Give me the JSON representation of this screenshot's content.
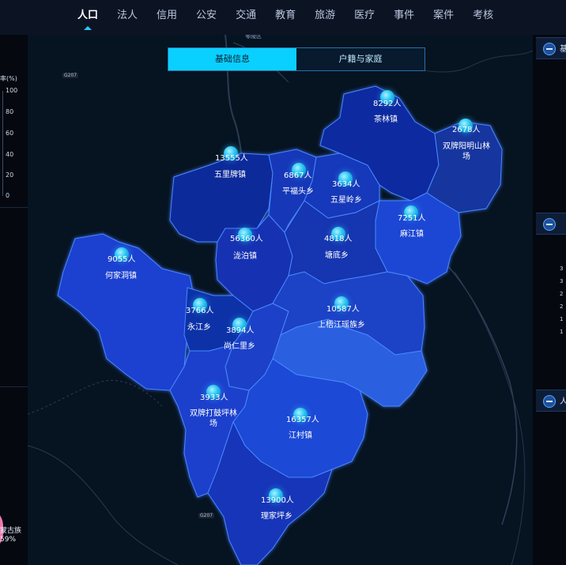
{
  "nav": {
    "tabs": [
      "人口",
      "法人",
      "信用",
      "公安",
      "交通",
      "教育",
      "旅游",
      "医疗",
      "事件",
      "案件",
      "考核"
    ],
    "active": "人口"
  },
  "segment": {
    "tab1": "基础信息",
    "tab2": "户籍与家庭",
    "active": "基础信息"
  },
  "left_panel": {
    "title": "率(%)",
    "ticks": [
      "100",
      "80",
      "60",
      "40",
      "20",
      "0"
    ],
    "pie_label_line1": "蒙古族",
    "pie_label_line2": "59%"
  },
  "right_panel": {
    "headers": [
      "基",
      "",
      "人"
    ],
    "numbers": [
      "3",
      "3",
      "2",
      "2",
      "1",
      "1"
    ]
  },
  "map": {
    "regions": [
      {
        "name": "茶林镇",
        "value": "8292人"
      },
      {
        "name": "双牌阳明山林场",
        "value": "2678人"
      },
      {
        "name": "五里牌镇",
        "value": "13555人"
      },
      {
        "name": "平福头乡",
        "value": "6867人"
      },
      {
        "name": "五星岭乡",
        "value": "3634人"
      },
      {
        "name": "麻江镇",
        "value": "7251人"
      },
      {
        "name": "泷泊镇",
        "value": "56360人"
      },
      {
        "name": "塘底乡",
        "value": "4818人"
      },
      {
        "name": "何家洞镇",
        "value": "9055人"
      },
      {
        "name": "上梧江瑶族乡",
        "value": "10587人"
      },
      {
        "name": "永江乡",
        "value": "3766人"
      },
      {
        "name": "尚仁里乡",
        "value": "3894人"
      },
      {
        "name": "双牌打鼓坪林场",
        "value": "3933人"
      },
      {
        "name": "江村镇",
        "value": "16357人"
      },
      {
        "name": "理家坪乡",
        "value": "13900人"
      }
    ],
    "roads": [
      "G207",
      "G207"
    ],
    "district_label": "零陵区"
  },
  "colors": {
    "accent": "#0ad0ff",
    "region_dark": "#0c2aa6",
    "region_mid": "#1f48c9",
    "region_light": "#2e63db"
  }
}
